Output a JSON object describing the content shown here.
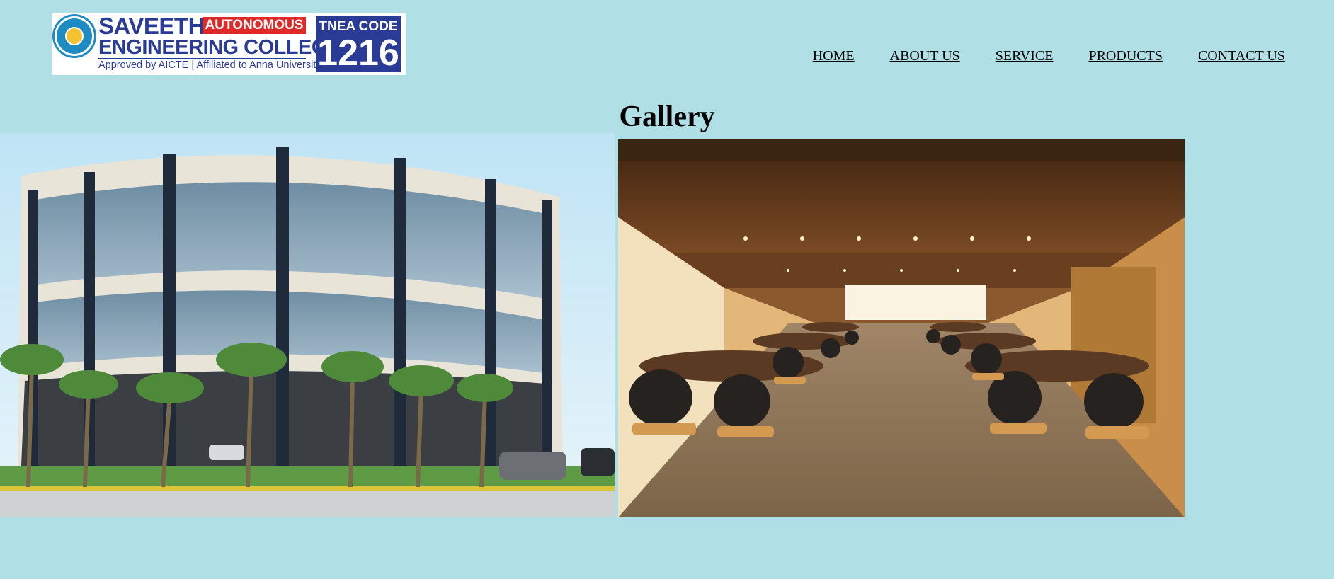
{
  "logo": {
    "name_line1": "SAVEETHA",
    "name_line2": "ENGINEERING COLLEGE",
    "badge": "AUTONOMOUS",
    "tagline": "Approved by AICTE  |  Affiliated to Anna University",
    "tnea_label": "TNEA CODE",
    "tnea_code": "1216",
    "colors": {
      "primary": "#2a3b96",
      "badge": "#e02a2a"
    }
  },
  "nav": {
    "items": [
      {
        "label": "HOME"
      },
      {
        "label": "ABOUT US"
      },
      {
        "label": "SERVICE"
      },
      {
        "label": "PRODUCTS"
      },
      {
        "label": "CONTACT US"
      }
    ]
  },
  "gallery": {
    "title": "Gallery",
    "images": [
      {
        "subject": "college building with palm trees"
      },
      {
        "subject": "conference hall with round tables and chairs"
      }
    ]
  },
  "colors": {
    "page_background": "#b0e0e6"
  }
}
